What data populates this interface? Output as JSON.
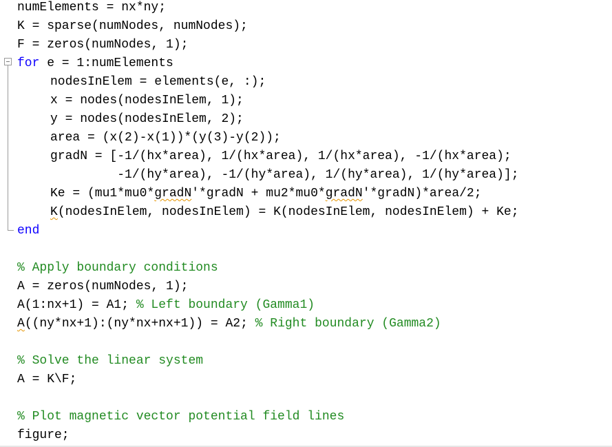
{
  "editor": {
    "colors": {
      "keyword": "#0e00ff",
      "comment": "#228b22",
      "text": "#000000",
      "warning_underline": "#e69500"
    },
    "lines": [
      {
        "indent": 0,
        "segments": [
          {
            "text": "numElements = nx*ny;",
            "type": "code"
          }
        ]
      },
      {
        "indent": 0,
        "segments": [
          {
            "text": "K = sparse(numNodes, numNodes);",
            "type": "code"
          }
        ]
      },
      {
        "indent": 0,
        "segments": [
          {
            "text": "F = zeros(numNodes, 1);",
            "type": "code"
          }
        ]
      },
      {
        "indent": 0,
        "segments": [
          {
            "text": "for",
            "type": "keyword"
          },
          {
            "text": " e = 1:numElements",
            "type": "code"
          }
        ]
      },
      {
        "indent": 1,
        "segments": [
          {
            "text": "nodesInElem = elements(e, :);",
            "type": "code"
          }
        ]
      },
      {
        "indent": 1,
        "segments": [
          {
            "text": "x = nodes(nodesInElem, 1);",
            "type": "code"
          }
        ]
      },
      {
        "indent": 1,
        "segments": [
          {
            "text": "y = nodes(nodesInElem, 2);",
            "type": "code"
          }
        ]
      },
      {
        "indent": 1,
        "segments": [
          {
            "text": "area = (x(2)-x(1))*(y(3)-y(2));",
            "type": "code"
          }
        ]
      },
      {
        "indent": 1,
        "segments": [
          {
            "text": "gradN = [-1/(hx*area), 1/(hx*area), 1/(hx*area), -1/(hx*area);",
            "type": "code"
          }
        ]
      },
      {
        "indent": 1,
        "segments": [
          {
            "text": "         -1/(hy*area), -1/(hy*area), 1/(hy*area), 1/(hy*area)];",
            "type": "code"
          }
        ]
      },
      {
        "indent": 1,
        "segments": [
          {
            "text": "Ke = (mu1*mu0*",
            "type": "code"
          },
          {
            "text": "gradN",
            "type": "warning"
          },
          {
            "text": "'*gradN + mu2*mu0*",
            "type": "code"
          },
          {
            "text": "gradN",
            "type": "warning"
          },
          {
            "text": "'*gradN)*area/2;",
            "type": "code"
          }
        ]
      },
      {
        "indent": 1,
        "segments": [
          {
            "text": "K",
            "type": "warning"
          },
          {
            "text": "(nodesInElem, nodesInElem) = K(nodesInElem, nodesInElem) + Ke;",
            "type": "code"
          }
        ]
      },
      {
        "indent": 0,
        "segments": [
          {
            "text": "end",
            "type": "keyword"
          }
        ]
      },
      {
        "indent": 0,
        "segments": []
      },
      {
        "indent": 0,
        "segments": [
          {
            "text": "% Apply boundary conditions",
            "type": "comment"
          }
        ]
      },
      {
        "indent": 0,
        "segments": [
          {
            "text": "A = zeros(numNodes, 1);",
            "type": "code"
          }
        ]
      },
      {
        "indent": 0,
        "segments": [
          {
            "text": "A(1:nx+1) = A1; ",
            "type": "code"
          },
          {
            "text": "% Left boundary (Gamma1)",
            "type": "comment"
          }
        ]
      },
      {
        "indent": 0,
        "segments": [
          {
            "text": "A",
            "type": "warning"
          },
          {
            "text": "((ny*nx+1):(ny*nx+nx+1)) = A2; ",
            "type": "code"
          },
          {
            "text": "% Right boundary (Gamma2)",
            "type": "comment"
          }
        ]
      },
      {
        "indent": 0,
        "segments": []
      },
      {
        "indent": 0,
        "segments": [
          {
            "text": "% Solve the linear system",
            "type": "comment"
          }
        ]
      },
      {
        "indent": 0,
        "segments": [
          {
            "text": "A = K\\F;",
            "type": "code"
          }
        ]
      },
      {
        "indent": 0,
        "segments": []
      },
      {
        "indent": 0,
        "segments": [
          {
            "text": "% Plot magnetic vector potential field lines",
            "type": "comment"
          }
        ]
      },
      {
        "indent": 0,
        "segments": [
          {
            "text": "figure;",
            "type": "code"
          }
        ]
      }
    ],
    "fold": {
      "icon": "minus-box-icon",
      "state": "expanded"
    }
  }
}
